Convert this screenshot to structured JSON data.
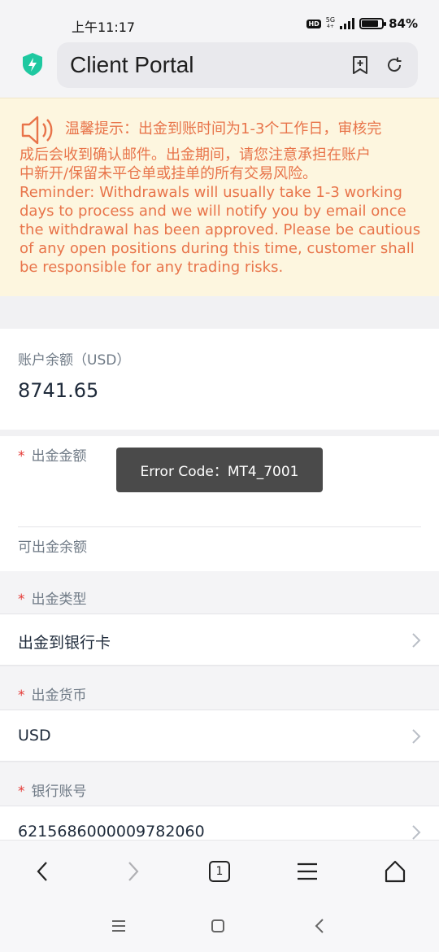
{
  "status_bar": {
    "time": "上午11:17",
    "hd": "HD",
    "network": "5G",
    "network_sub": "4+",
    "battery_percent": "84%",
    "battery_level": 0.84
  },
  "browser": {
    "title": "Client Portal",
    "icons": [
      "shield-icon",
      "bookmark-add-icon",
      "reload-icon"
    ],
    "toolbar": {
      "tab_count": "1",
      "icons": [
        "back-icon",
        "forward-icon",
        "tabs-icon",
        "menu-icon",
        "home-icon"
      ]
    }
  },
  "notice": {
    "zh": "温馨提示：出金到账时间为1-3个工作日，审核完成后会收到确认邮件。出金期间，请您注意承担在账户中新开/保留未平仓单或挂单的所有交易风险。",
    "zh_line1": "温馨提示：出金到账时间为1-3个工作日，审核完",
    "zh_line2": "成后会收到确认邮件。出金期间，请您注意承担在账户",
    "zh_line3": "中新开/保留未平仓单或挂单的所有交易风险。",
    "en": "Reminder: Withdrawals will usually take 1-3 working days to process and we will notify you by email once the withdrawal has been approved. Please be cautious of any open positions during this time, customer shall be responsible for any trading risks.",
    "accent_color": "#e8744a"
  },
  "balance": {
    "label": "账户余额（USD）",
    "value": "8741.65"
  },
  "form": {
    "required_mark": "*",
    "amount_label": "出金金额",
    "amount_value": "",
    "available_label": "可出金余额",
    "type_label": "出金类型",
    "type_value": "出金到银行卡",
    "currency_label": "出金货币",
    "currency_value": "USD",
    "account_label": "银行账号",
    "account_value": "6215686000009782060"
  },
  "toast": {
    "text": "Error Code：MT4_7001"
  },
  "system_nav": {
    "icons": [
      "recent-apps-icon",
      "home-square-icon",
      "back-nav-icon"
    ]
  }
}
